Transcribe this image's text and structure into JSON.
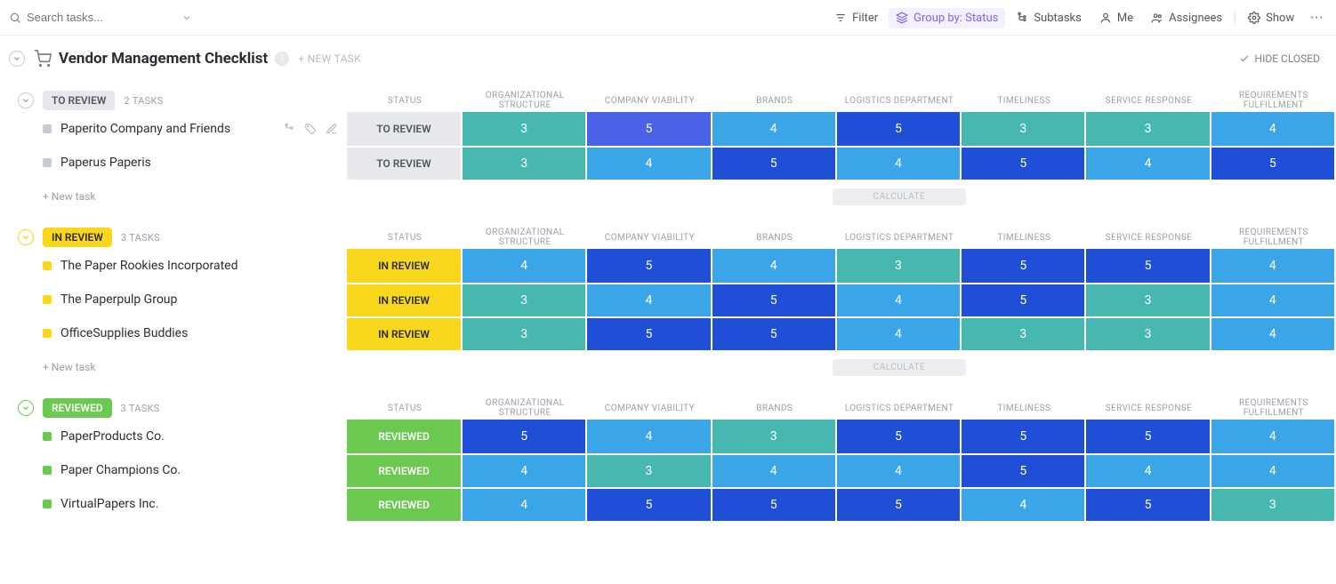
{
  "search": {
    "placeholder": "Search tasks..."
  },
  "toolbar": {
    "filter": "Filter",
    "group_by": "Group by: Status",
    "subtasks": "Subtasks",
    "me": "Me",
    "assignees": "Assignees",
    "show": "Show"
  },
  "list": {
    "title": "Vendor Management Checklist",
    "new_task_label": "+ NEW TASK",
    "hide_closed": "HIDE CLOSED"
  },
  "columns": [
    "STATUS",
    "ORGANIZATIONAL STRUCTURE",
    "COMPANY VIABILITY",
    "BRANDS",
    "LOGISTICS DEPARTMENT",
    "TIMELINESS",
    "SERVICE RESPONSE",
    "REQUIREMENTS FULFILLMENT"
  ],
  "footer": {
    "new_task": "+ New task",
    "calculate": "CALCULATE"
  },
  "value_colors": {
    "3": "#46b8b0",
    "4": "#3aa6e8",
    "5": "#1f4fd6",
    "5b": "#4a62e8"
  },
  "groups": [
    {
      "key": "toreview",
      "label": "TO REVIEW",
      "count_label": "2 TASKS",
      "status_text": "TO REVIEW",
      "show_footer": true,
      "show_hover_first_row": true,
      "tasks": [
        {
          "name": "Paperito Company and Friends",
          "cells": [
            {
              "t": "3",
              "c": "3"
            },
            {
              "t": "5",
              "c": "5b"
            },
            {
              "t": "4",
              "c": "4"
            },
            {
              "t": "5",
              "c": "5"
            },
            {
              "t": "3",
              "c": "3"
            },
            {
              "t": "3",
              "c": "3"
            },
            {
              "t": "4",
              "c": "4"
            }
          ]
        },
        {
          "name": "Paperus Paperis",
          "cells": [
            {
              "t": "3",
              "c": "3"
            },
            {
              "t": "4",
              "c": "4"
            },
            {
              "t": "5",
              "c": "5"
            },
            {
              "t": "4",
              "c": "4"
            },
            {
              "t": "5",
              "c": "5"
            },
            {
              "t": "4",
              "c": "4"
            },
            {
              "t": "5",
              "c": "5"
            }
          ]
        }
      ]
    },
    {
      "key": "inreview",
      "label": "IN REVIEW",
      "count_label": "3 TASKS",
      "status_text": "IN REVIEW",
      "show_footer": true,
      "tasks": [
        {
          "name": "The Paper Rookies Incorporated",
          "cells": [
            {
              "t": "4",
              "c": "4"
            },
            {
              "t": "5",
              "c": "5"
            },
            {
              "t": "4",
              "c": "4"
            },
            {
              "t": "3",
              "c": "3"
            },
            {
              "t": "5",
              "c": "5"
            },
            {
              "t": "5",
              "c": "5"
            },
            {
              "t": "4",
              "c": "4"
            }
          ]
        },
        {
          "name": "The Paperpulp Group",
          "cells": [
            {
              "t": "3",
              "c": "3"
            },
            {
              "t": "4",
              "c": "4"
            },
            {
              "t": "5",
              "c": "5"
            },
            {
              "t": "4",
              "c": "4"
            },
            {
              "t": "5",
              "c": "5"
            },
            {
              "t": "3",
              "c": "3"
            },
            {
              "t": "4",
              "c": "4"
            }
          ]
        },
        {
          "name": "OfficeSupplies Buddies",
          "cells": [
            {
              "t": "3",
              "c": "3"
            },
            {
              "t": "5",
              "c": "5"
            },
            {
              "t": "5",
              "c": "5"
            },
            {
              "t": "4",
              "c": "4"
            },
            {
              "t": "3",
              "c": "3"
            },
            {
              "t": "3",
              "c": "3"
            },
            {
              "t": "4",
              "c": "4"
            }
          ]
        }
      ]
    },
    {
      "key": "reviewed",
      "label": "REVIEWED",
      "count_label": "3 TASKS",
      "status_text": "REVIEWED",
      "show_footer": false,
      "tasks": [
        {
          "name": "PaperProducts Co.",
          "cells": [
            {
              "t": "5",
              "c": "5"
            },
            {
              "t": "4",
              "c": "4"
            },
            {
              "t": "3",
              "c": "3"
            },
            {
              "t": "5",
              "c": "5"
            },
            {
              "t": "5",
              "c": "5"
            },
            {
              "t": "5",
              "c": "5"
            },
            {
              "t": "4",
              "c": "4"
            }
          ]
        },
        {
          "name": "Paper Champions Co.",
          "cells": [
            {
              "t": "4",
              "c": "4"
            },
            {
              "t": "3",
              "c": "3"
            },
            {
              "t": "4",
              "c": "4"
            },
            {
              "t": "4",
              "c": "4"
            },
            {
              "t": "5",
              "c": "5"
            },
            {
              "t": "4",
              "c": "4"
            },
            {
              "t": "4",
              "c": "4"
            }
          ]
        },
        {
          "name": "VirtualPapers Inc.",
          "cells": [
            {
              "t": "4",
              "c": "4"
            },
            {
              "t": "5",
              "c": "5"
            },
            {
              "t": "5",
              "c": "5"
            },
            {
              "t": "5",
              "c": "5"
            },
            {
              "t": "4",
              "c": "4"
            },
            {
              "t": "5",
              "c": "5"
            },
            {
              "t": "3",
              "c": "3"
            }
          ]
        }
      ]
    }
  ]
}
